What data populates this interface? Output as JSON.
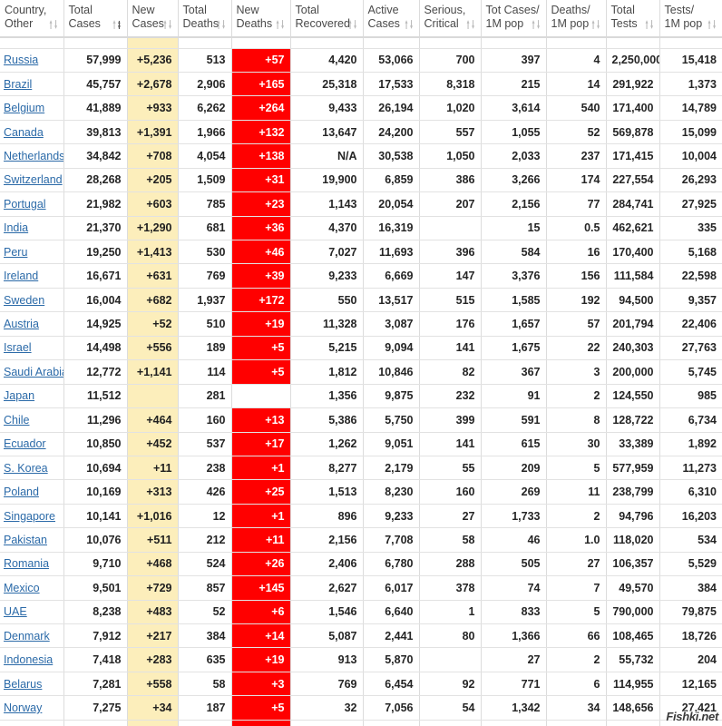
{
  "table": {
    "columns": [
      {
        "line1": "Country,",
        "line2": "Other",
        "sort": "both",
        "key": "country"
      },
      {
        "line1": "Total",
        "line2": "Cases",
        "sort": "desc-active",
        "key": "total_cases"
      },
      {
        "line1": "New",
        "line2": "Cases",
        "sort": "both",
        "key": "new_cases"
      },
      {
        "line1": "Total",
        "line2": "Deaths",
        "sort": "both",
        "key": "total_deaths"
      },
      {
        "line1": "New",
        "line2": "Deaths",
        "sort": "both",
        "key": "new_deaths"
      },
      {
        "line1": "Total",
        "line2": "Recovered",
        "sort": "both",
        "key": "total_recovered"
      },
      {
        "line1": "Active",
        "line2": "Cases",
        "sort": "both",
        "key": "active_cases"
      },
      {
        "line1": "Serious,",
        "line2": "Critical",
        "sort": "both",
        "key": "serious_critical"
      },
      {
        "line1": "Tot Cases/",
        "line2": "1M pop",
        "sort": "both",
        "key": "tot_cases_per_1m"
      },
      {
        "line1": "Deaths/",
        "line2": "1M pop",
        "sort": "both",
        "key": "deaths_per_1m"
      },
      {
        "line1": "Total",
        "line2": "Tests",
        "sort": "both",
        "key": "total_tests"
      },
      {
        "line1": "Tests/",
        "line2": "1M pop",
        "sort": "both",
        "key": "tests_per_1m"
      }
    ],
    "rows": [
      {
        "country": "Russia",
        "total_cases": "57,999",
        "new_cases": "+5,236",
        "total_deaths": "513",
        "new_deaths": "+57",
        "total_recovered": "4,420",
        "active_cases": "53,066",
        "serious_critical": "700",
        "tot_cases_per_1m": "397",
        "deaths_per_1m": "4",
        "total_tests": "2,250,000",
        "tests_per_1m": "15,418"
      },
      {
        "country": "Brazil",
        "total_cases": "45,757",
        "new_cases": "+2,678",
        "total_deaths": "2,906",
        "new_deaths": "+165",
        "total_recovered": "25,318",
        "active_cases": "17,533",
        "serious_critical": "8,318",
        "tot_cases_per_1m": "215",
        "deaths_per_1m": "14",
        "total_tests": "291,922",
        "tests_per_1m": "1,373"
      },
      {
        "country": "Belgium",
        "total_cases": "41,889",
        "new_cases": "+933",
        "total_deaths": "6,262",
        "new_deaths": "+264",
        "total_recovered": "9,433",
        "active_cases": "26,194",
        "serious_critical": "1,020",
        "tot_cases_per_1m": "3,614",
        "deaths_per_1m": "540",
        "total_tests": "171,400",
        "tests_per_1m": "14,789"
      },
      {
        "country": "Canada",
        "total_cases": "39,813",
        "new_cases": "+1,391",
        "total_deaths": "1,966",
        "new_deaths": "+132",
        "total_recovered": "13,647",
        "active_cases": "24,200",
        "serious_critical": "557",
        "tot_cases_per_1m": "1,055",
        "deaths_per_1m": "52",
        "total_tests": "569,878",
        "tests_per_1m": "15,099"
      },
      {
        "country": "Netherlands",
        "total_cases": "34,842",
        "new_cases": "+708",
        "total_deaths": "4,054",
        "new_deaths": "+138",
        "total_recovered": "N/A",
        "active_cases": "30,538",
        "serious_critical": "1,050",
        "tot_cases_per_1m": "2,033",
        "deaths_per_1m": "237",
        "total_tests": "171,415",
        "tests_per_1m": "10,004"
      },
      {
        "country": "Switzerland",
        "total_cases": "28,268",
        "new_cases": "+205",
        "total_deaths": "1,509",
        "new_deaths": "+31",
        "total_recovered": "19,900",
        "active_cases": "6,859",
        "serious_critical": "386",
        "tot_cases_per_1m": "3,266",
        "deaths_per_1m": "174",
        "total_tests": "227,554",
        "tests_per_1m": "26,293"
      },
      {
        "country": "Portugal",
        "total_cases": "21,982",
        "new_cases": "+603",
        "total_deaths": "785",
        "new_deaths": "+23",
        "total_recovered": "1,143",
        "active_cases": "20,054",
        "serious_critical": "207",
        "tot_cases_per_1m": "2,156",
        "deaths_per_1m": "77",
        "total_tests": "284,741",
        "tests_per_1m": "27,925"
      },
      {
        "country": "India",
        "total_cases": "21,370",
        "new_cases": "+1,290",
        "total_deaths": "681",
        "new_deaths": "+36",
        "total_recovered": "4,370",
        "active_cases": "16,319",
        "serious_critical": "",
        "tot_cases_per_1m": "15",
        "deaths_per_1m": "0.5",
        "total_tests": "462,621",
        "tests_per_1m": "335"
      },
      {
        "country": "Peru",
        "total_cases": "19,250",
        "new_cases": "+1,413",
        "total_deaths": "530",
        "new_deaths": "+46",
        "total_recovered": "7,027",
        "active_cases": "11,693",
        "serious_critical": "396",
        "tot_cases_per_1m": "584",
        "deaths_per_1m": "16",
        "total_tests": "170,400",
        "tests_per_1m": "5,168"
      },
      {
        "country": "Ireland",
        "total_cases": "16,671",
        "new_cases": "+631",
        "total_deaths": "769",
        "new_deaths": "+39",
        "total_recovered": "9,233",
        "active_cases": "6,669",
        "serious_critical": "147",
        "tot_cases_per_1m": "3,376",
        "deaths_per_1m": "156",
        "total_tests": "111,584",
        "tests_per_1m": "22,598"
      },
      {
        "country": "Sweden",
        "total_cases": "16,004",
        "new_cases": "+682",
        "total_deaths": "1,937",
        "new_deaths": "+172",
        "total_recovered": "550",
        "active_cases": "13,517",
        "serious_critical": "515",
        "tot_cases_per_1m": "1,585",
        "deaths_per_1m": "192",
        "total_tests": "94,500",
        "tests_per_1m": "9,357"
      },
      {
        "country": "Austria",
        "total_cases": "14,925",
        "new_cases": "+52",
        "total_deaths": "510",
        "new_deaths": "+19",
        "total_recovered": "11,328",
        "active_cases": "3,087",
        "serious_critical": "176",
        "tot_cases_per_1m": "1,657",
        "deaths_per_1m": "57",
        "total_tests": "201,794",
        "tests_per_1m": "22,406"
      },
      {
        "country": "Israel",
        "total_cases": "14,498",
        "new_cases": "+556",
        "total_deaths": "189",
        "new_deaths": "+5",
        "total_recovered": "5,215",
        "active_cases": "9,094",
        "serious_critical": "141",
        "tot_cases_per_1m": "1,675",
        "deaths_per_1m": "22",
        "total_tests": "240,303",
        "tests_per_1m": "27,763"
      },
      {
        "country": "Saudi Arabia",
        "total_cases": "12,772",
        "new_cases": "+1,141",
        "total_deaths": "114",
        "new_deaths": "+5",
        "total_recovered": "1,812",
        "active_cases": "10,846",
        "serious_critical": "82",
        "tot_cases_per_1m": "367",
        "deaths_per_1m": "3",
        "total_tests": "200,000",
        "tests_per_1m": "5,745"
      },
      {
        "country": "Japan",
        "total_cases": "11,512",
        "new_cases": "",
        "total_deaths": "281",
        "new_deaths": "",
        "total_recovered": "1,356",
        "active_cases": "9,875",
        "serious_critical": "232",
        "tot_cases_per_1m": "91",
        "deaths_per_1m": "2",
        "total_tests": "124,550",
        "tests_per_1m": "985"
      },
      {
        "country": "Chile",
        "total_cases": "11,296",
        "new_cases": "+464",
        "total_deaths": "160",
        "new_deaths": "+13",
        "total_recovered": "5,386",
        "active_cases": "5,750",
        "serious_critical": "399",
        "tot_cases_per_1m": "591",
        "deaths_per_1m": "8",
        "total_tests": "128,722",
        "tests_per_1m": "6,734"
      },
      {
        "country": "Ecuador",
        "total_cases": "10,850",
        "new_cases": "+452",
        "total_deaths": "537",
        "new_deaths": "+17",
        "total_recovered": "1,262",
        "active_cases": "9,051",
        "serious_critical": "141",
        "tot_cases_per_1m": "615",
        "deaths_per_1m": "30",
        "total_tests": "33,389",
        "tests_per_1m": "1,892"
      },
      {
        "country": "S. Korea",
        "total_cases": "10,694",
        "new_cases": "+11",
        "total_deaths": "238",
        "new_deaths": "+1",
        "total_recovered": "8,277",
        "active_cases": "2,179",
        "serious_critical": "55",
        "tot_cases_per_1m": "209",
        "deaths_per_1m": "5",
        "total_tests": "577,959",
        "tests_per_1m": "11,273"
      },
      {
        "country": "Poland",
        "total_cases": "10,169",
        "new_cases": "+313",
        "total_deaths": "426",
        "new_deaths": "+25",
        "total_recovered": "1,513",
        "active_cases": "8,230",
        "serious_critical": "160",
        "tot_cases_per_1m": "269",
        "deaths_per_1m": "11",
        "total_tests": "238,799",
        "tests_per_1m": "6,310"
      },
      {
        "country": "Singapore",
        "total_cases": "10,141",
        "new_cases": "+1,016",
        "total_deaths": "12",
        "new_deaths": "+1",
        "total_recovered": "896",
        "active_cases": "9,233",
        "serious_critical": "27",
        "tot_cases_per_1m": "1,733",
        "deaths_per_1m": "2",
        "total_tests": "94,796",
        "tests_per_1m": "16,203"
      },
      {
        "country": "Pakistan",
        "total_cases": "10,076",
        "new_cases": "+511",
        "total_deaths": "212",
        "new_deaths": "+11",
        "total_recovered": "2,156",
        "active_cases": "7,708",
        "serious_critical": "58",
        "tot_cases_per_1m": "46",
        "deaths_per_1m": "1.0",
        "total_tests": "118,020",
        "tests_per_1m": "534"
      },
      {
        "country": "Romania",
        "total_cases": "9,710",
        "new_cases": "+468",
        "total_deaths": "524",
        "new_deaths": "+26",
        "total_recovered": "2,406",
        "active_cases": "6,780",
        "serious_critical": "288",
        "tot_cases_per_1m": "505",
        "deaths_per_1m": "27",
        "total_tests": "106,357",
        "tests_per_1m": "5,529"
      },
      {
        "country": "Mexico",
        "total_cases": "9,501",
        "new_cases": "+729",
        "total_deaths": "857",
        "new_deaths": "+145",
        "total_recovered": "2,627",
        "active_cases": "6,017",
        "serious_critical": "378",
        "tot_cases_per_1m": "74",
        "deaths_per_1m": "7",
        "total_tests": "49,570",
        "tests_per_1m": "384"
      },
      {
        "country": "UAE",
        "total_cases": "8,238",
        "new_cases": "+483",
        "total_deaths": "52",
        "new_deaths": "+6",
        "total_recovered": "1,546",
        "active_cases": "6,640",
        "serious_critical": "1",
        "tot_cases_per_1m": "833",
        "deaths_per_1m": "5",
        "total_tests": "790,000",
        "tests_per_1m": "79,875"
      },
      {
        "country": "Denmark",
        "total_cases": "7,912",
        "new_cases": "+217",
        "total_deaths": "384",
        "new_deaths": "+14",
        "total_recovered": "5,087",
        "active_cases": "2,441",
        "serious_critical": "80",
        "tot_cases_per_1m": "1,366",
        "deaths_per_1m": "66",
        "total_tests": "108,465",
        "tests_per_1m": "18,726"
      },
      {
        "country": "Indonesia",
        "total_cases": "7,418",
        "new_cases": "+283",
        "total_deaths": "635",
        "new_deaths": "+19",
        "total_recovered": "913",
        "active_cases": "5,870",
        "serious_critical": "",
        "tot_cases_per_1m": "27",
        "deaths_per_1m": "2",
        "total_tests": "55,732",
        "tests_per_1m": "204"
      },
      {
        "country": "Belarus",
        "total_cases": "7,281",
        "new_cases": "+558",
        "total_deaths": "58",
        "new_deaths": "+3",
        "total_recovered": "769",
        "active_cases": "6,454",
        "serious_critical": "92",
        "tot_cases_per_1m": "771",
        "deaths_per_1m": "6",
        "total_tests": "114,955",
        "tests_per_1m": "12,165"
      },
      {
        "country": "Norway",
        "total_cases": "7,275",
        "new_cases": "+34",
        "total_deaths": "187",
        "new_deaths": "+5",
        "total_recovered": "32",
        "active_cases": "7,056",
        "serious_critical": "54",
        "tot_cases_per_1m": "1,342",
        "deaths_per_1m": "34",
        "total_tests": "148,656",
        "tests_per_1m": "27,421"
      }
    ]
  },
  "watermark": {
    "text": "Fishki.net"
  },
  "colors": {
    "new_cases_bg": "#fceebb",
    "new_deaths_bg": "#ff0000",
    "link": "#2b6aa8",
    "border": "#dcdcdc"
  }
}
